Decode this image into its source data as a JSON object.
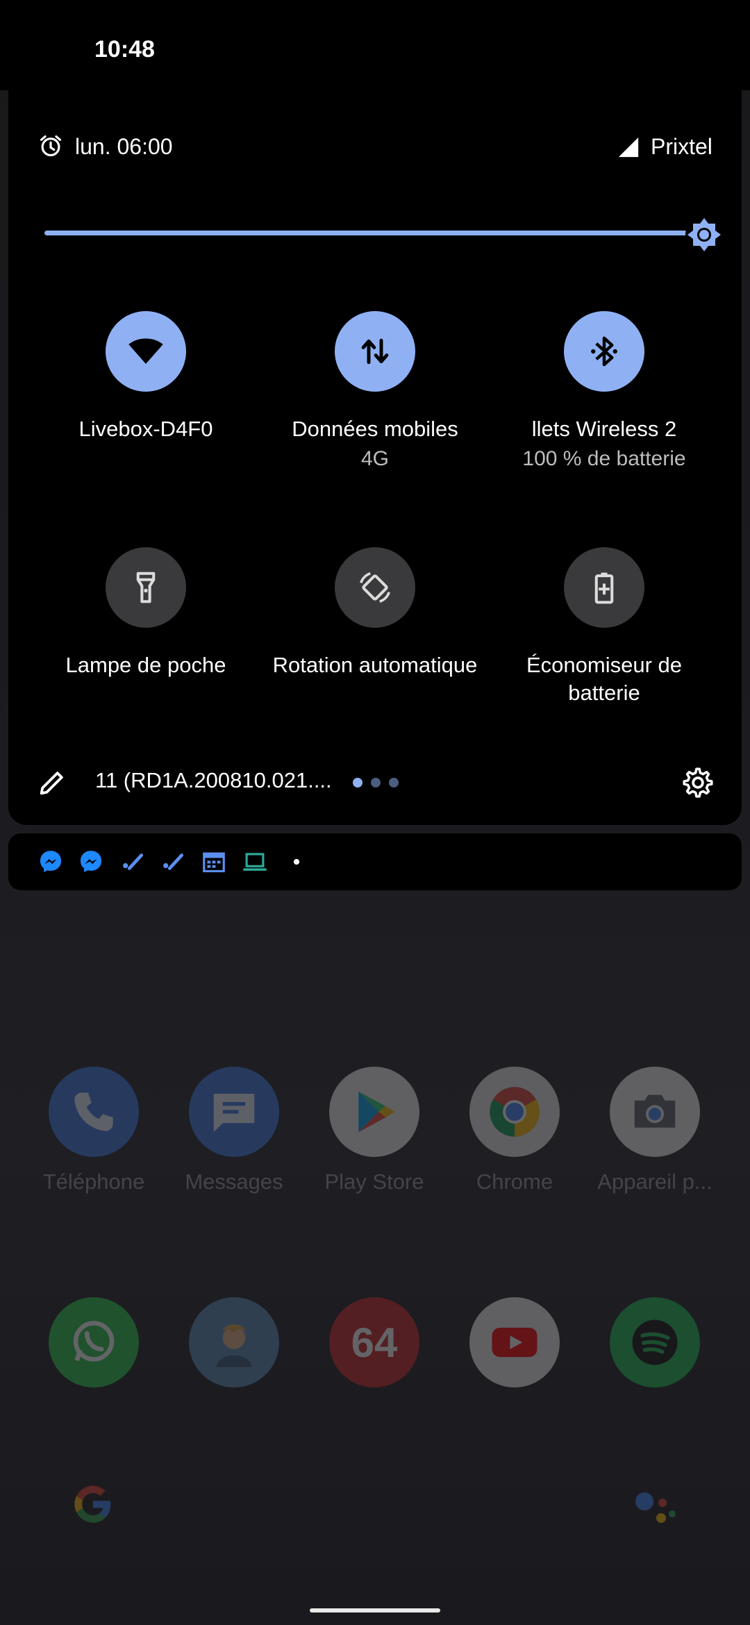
{
  "status_bar": {
    "time": "10:48"
  },
  "quick_settings": {
    "alarm": "lun. 06:00",
    "carrier": "Prixtel",
    "brightness_level": 1.0,
    "tiles": [
      {
        "label": "Livebox-D4F0",
        "sub": "",
        "icon": "wifi-icon",
        "active": true
      },
      {
        "label": "Données mobiles",
        "sub": "4G",
        "icon": "mobile-data-icon",
        "active": true
      },
      {
        "label": "llets Wireless 2",
        "sub": "100 % de batterie",
        "icon": "bluetooth-icon",
        "active": true
      },
      {
        "label": "Lampe de poche",
        "sub": "",
        "icon": "flashlight-icon",
        "active": false
      },
      {
        "label": "Rotation automatique",
        "sub": "",
        "icon": "auto-rotate-icon",
        "active": false
      },
      {
        "label": "Économiseur de batterie",
        "sub": "",
        "icon": "battery-saver-icon",
        "active": false
      }
    ],
    "build_number": "11 (RD1A.200810.021....",
    "page_count": 3,
    "active_page": 1,
    "accent_color": "#8fb1f4"
  },
  "notification_icons": [
    "messenger-icon",
    "messenger-icon",
    "tasks-icon",
    "tasks-icon",
    "calendar-icon",
    "laptop-icon",
    "more-dot-icon"
  ],
  "home": {
    "dock_row_1": [
      {
        "label": "Téléphone",
        "icon": "phone-icon"
      },
      {
        "label": "Messages",
        "icon": "messages-icon"
      },
      {
        "label": "Play Store",
        "icon": "play-store-icon"
      },
      {
        "label": "Chrome",
        "icon": "chrome-icon"
      },
      {
        "label": "Appareil p...",
        "icon": "camera-icon"
      }
    ],
    "row_2": [
      {
        "label": "",
        "icon": "whatsapp-icon"
      },
      {
        "label": "",
        "icon": "game-avatar-icon"
      },
      {
        "label": "",
        "icon": "emulator-64-icon",
        "text": "64"
      },
      {
        "label": "",
        "icon": "youtube-icon"
      },
      {
        "label": "",
        "icon": "spotify-icon"
      }
    ]
  }
}
